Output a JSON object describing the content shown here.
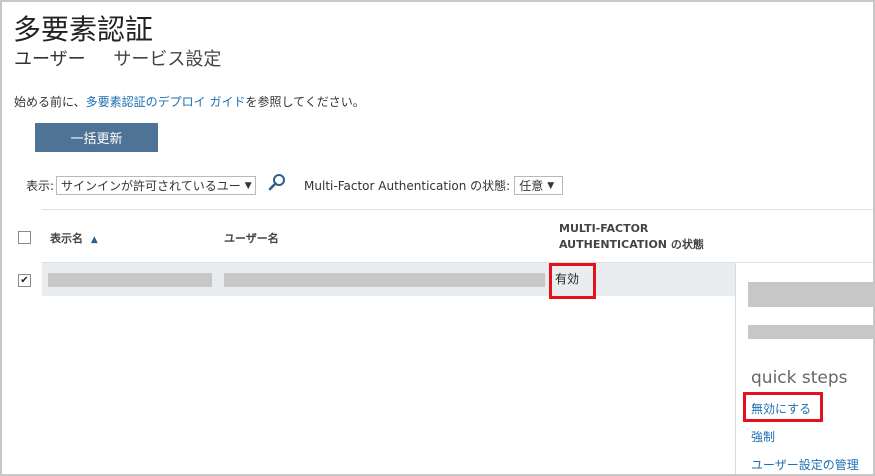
{
  "page": {
    "title": "多要素認証",
    "tabs": [
      "ユーザー",
      "サービス設定"
    ],
    "intro_prefix": "始める前に、",
    "intro_link": "多要素認証のデプロイ ガイド",
    "intro_suffix": "を参照してください。",
    "bulk_update_label": "一括更新"
  },
  "filters": {
    "view_label": "表示:",
    "view_value": "サインインが許可されているユー",
    "mfa_label": "Multi-Factor Authentication の状態:",
    "mfa_value": "任意",
    "search_icon": "search-icon"
  },
  "table": {
    "columns": {
      "display_name": "表示名",
      "sort_indicator": "▲",
      "user_name": "ユーザー名",
      "mfa_status_line1": "MULTI-FACTOR",
      "mfa_status_line2": "AUTHENTICATION の状態"
    },
    "rows": [
      {
        "selected": true,
        "display_name": "",
        "user_name": "",
        "mfa_status": "有効"
      }
    ]
  },
  "side_panel": {
    "quick_steps_title": "quick steps",
    "actions": [
      "無効にする",
      "強制",
      "ユーザー設定の管理"
    ]
  },
  "highlight_color": "#e5121b",
  "accent_color": "#4e7394",
  "link_color": "#1f6fb2"
}
